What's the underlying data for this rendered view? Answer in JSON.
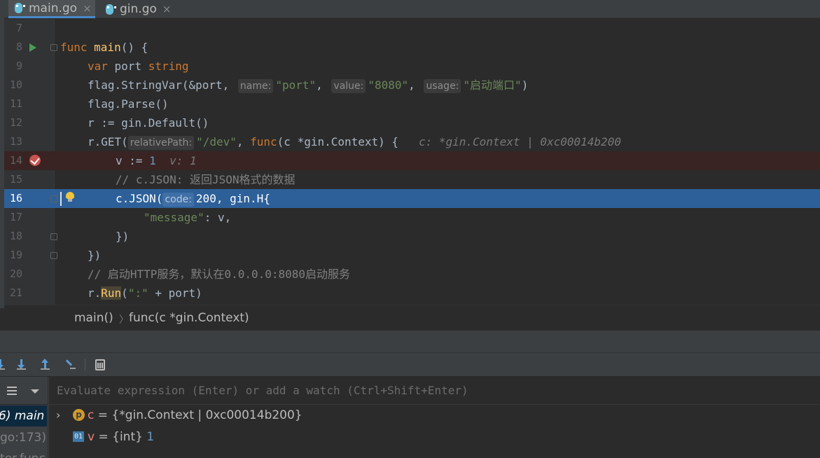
{
  "tabs": [
    {
      "label": "main.go",
      "active": true
    },
    {
      "label": "gin.go",
      "active": false
    }
  ],
  "tab_close_glyph": "×",
  "code": {
    "lines": [
      "7",
      "8",
      "9",
      "10",
      "11",
      "12",
      "13",
      "14",
      "15",
      "16",
      "17",
      "18",
      "19",
      "20",
      "21"
    ],
    "l9": {
      "kw1": "var",
      "id": " port ",
      "kw2": "string"
    },
    "l10": {
      "fn": "flag.StringVar(&port, ",
      "h1": "name:",
      "s1": "\"port\"",
      "c1": ", ",
      "h2": "value:",
      "s2": "\"8080\"",
      "c2": ", ",
      "h3": "usage:",
      "s3": "\"启动端口\"",
      "end": ")"
    },
    "l11": "flag.Parse()",
    "l12": "r := gin.Default()",
    "l13": {
      "a": "r.GET(",
      "h": "relativePath:",
      "s": "\"/dev\"",
      "b": ", ",
      "kw": "func",
      "c": "(c *gin.Context) {",
      "inline": "c: *gin.Context | 0xc00014b200"
    },
    "l14": {
      "a": "v := ",
      "n": "1",
      "inline": "v: 1"
    },
    "l15": "// c.JSON: 返回JSON格式的数据",
    "l16": {
      "a": "c.JSON(",
      "h": "code:",
      "n": "200",
      "b": ", gin.H{"
    },
    "l17": {
      "s": "\"message\"",
      "b": ": v,"
    },
    "l18": "})",
    "l19": "})",
    "l20": "// 启动HTTP服务，默认在0.0.0.0:8080启动服务",
    "l21": {
      "a": "r.",
      "fn": "Run",
      "b": "(",
      "s": "\":\"",
      "c": " + port)"
    },
    "l8": {
      "kw": "func",
      "fn": " main",
      "b": "() {"
    }
  },
  "breadcrumb": {
    "item1": "main()",
    "sep": "〉",
    "item2": "func(c *gin.Context)"
  },
  "debugger": {
    "eval_placeholder": "Evaluate expression (Enter) or add a watch (Ctrl+Shift+Enter)",
    "frames": [
      {
        "label": "6) main",
        "selected": true
      },
      {
        "label": "go:173)",
        "selected": false
      },
      {
        "label": "ter.func",
        "selected": false
      }
    ],
    "variables": [
      {
        "badge": "p",
        "name": "c",
        "eq": " = ",
        "value": "{*gin.Context | 0xc00014b200}",
        "expandable": true
      },
      {
        "badge": "01",
        "name": "v",
        "eq": " = ",
        "value": "{int} ",
        "num": "1",
        "expandable": false
      }
    ],
    "chevron": "›"
  },
  "colors": {
    "editor_bg": "#2b2b2b",
    "exec_line": "#2d6099",
    "breakpoint_line": "#3a2323",
    "keyword": "#cc7832",
    "string": "#6a8759",
    "number": "#6897bb",
    "function": "#ffc66d"
  },
  "icons": [
    "go-file-icon",
    "run-gutter-icon",
    "breakpoint-icon",
    "intention-bulb-icon",
    "step-over-icon",
    "step-into-icon",
    "step-out-icon",
    "run-to-cursor-icon",
    "evaluate-icon",
    "frames-menu-icon"
  ]
}
